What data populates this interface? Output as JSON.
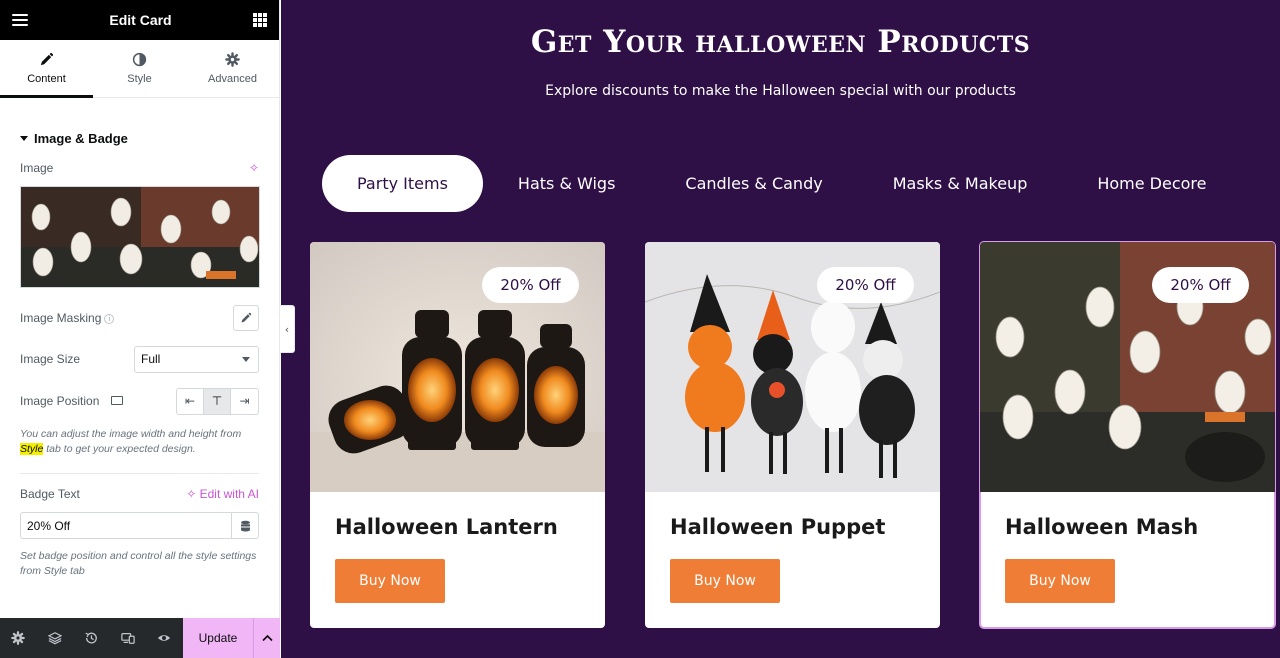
{
  "editor": {
    "title": "Edit Card",
    "tabs": [
      {
        "label": "Content",
        "icon": "pencil-icon"
      },
      {
        "label": "Style",
        "icon": "half-circle-icon"
      },
      {
        "label": "Advanced",
        "icon": "gear-icon"
      }
    ],
    "section_title": "Image & Badge",
    "image_label": "Image",
    "image_masking_label": "Image Masking",
    "image_size_label": "Image Size",
    "image_size_value": "Full",
    "image_position_label": "Image Position",
    "help_pre": "You can adjust the image width and height from ",
    "help_highlight": "Style",
    "help_post": " tab to get your expected design.",
    "badge_text_label": "Badge Text",
    "edit_with_ai": "Edit with AI",
    "badge_text_value": "20% Off",
    "badge_help": "Set badge position and control all the style settings from Style tab",
    "update_label": "Update",
    "accent_color": "#c855d3",
    "update_bg": "#f0b6f5"
  },
  "preview": {
    "title": "Get Your halloween Products",
    "subtitle": "Explore discounts to make the Halloween special with our products",
    "categories": [
      "Party Items",
      "Hats & Wigs",
      "Candles & Candy",
      "Masks & Makeup",
      "Home Decore"
    ],
    "active_category": "Party Items",
    "cards": [
      {
        "title": "Halloween Lantern",
        "badge": "20% Off",
        "button": "Buy Now"
      },
      {
        "title": "Halloween Puppet",
        "badge": "20% Off",
        "button": "Buy Now"
      },
      {
        "title": "Halloween Mash",
        "badge": "20% Off",
        "button": "Buy Now"
      }
    ],
    "background_color": "#2e0f46",
    "button_color": "#ef7d35"
  }
}
